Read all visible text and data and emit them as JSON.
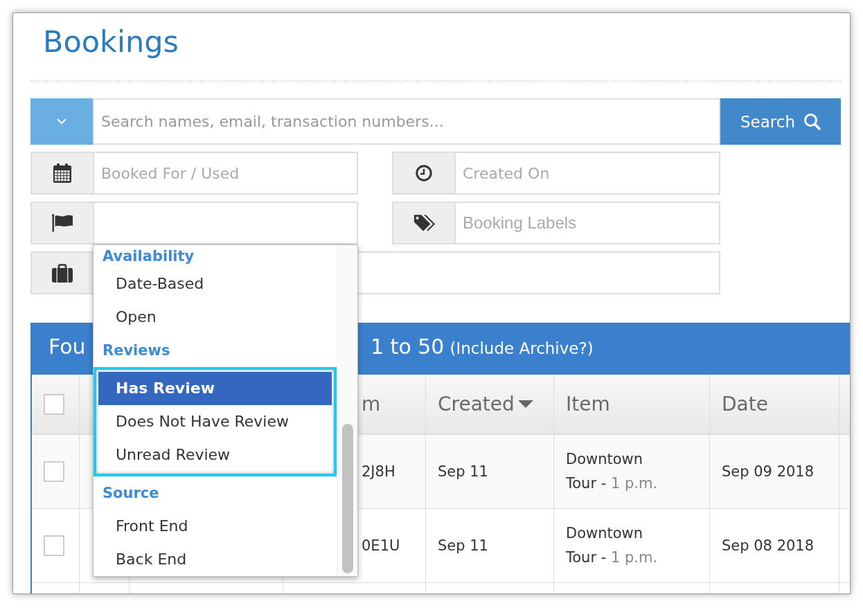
{
  "page": {
    "title": "Bookings"
  },
  "search": {
    "placeholder": "Search names, email, transaction numbers...",
    "button": "Search"
  },
  "filters": {
    "booked_for": {
      "placeholder": "Booked For / Used"
    },
    "created_on": {
      "placeholder": "Created On"
    },
    "flag_select": {
      "expanded": true,
      "groups": [
        {
          "label": "Availability",
          "highlighted": false,
          "options": [
            {
              "label": "Date-Based",
              "selected": false
            },
            {
              "label": "Open",
              "selected": false
            }
          ]
        },
        {
          "label": "Reviews",
          "highlighted": true,
          "options": [
            {
              "label": "Has Review",
              "selected": true
            },
            {
              "label": "Does Not Have Review",
              "selected": false
            },
            {
              "label": "Unread Review",
              "selected": false
            }
          ]
        },
        {
          "label": "Source",
          "highlighted": false,
          "options": [
            {
              "label": "Front End",
              "selected": false
            },
            {
              "label": "Back End",
              "selected": false
            }
          ]
        }
      ]
    },
    "labels": {
      "placeholder": "Booking Labels"
    }
  },
  "results_bar": {
    "text_start": "Fou",
    "text_end": "1 to 50",
    "archive_link": "(Include Archive?)"
  },
  "table": {
    "columns": [
      {
        "kind": "checkbox",
        "checked": false
      },
      {
        "kind": "blank"
      },
      {
        "kind": "blank"
      },
      {
        "kind": "text",
        "label": "m",
        "sorted": false
      },
      {
        "kind": "text",
        "label": "Created",
        "sorted": true
      },
      {
        "kind": "text",
        "label": "Item",
        "sorted": false
      },
      {
        "kind": "text",
        "label": "Date",
        "sorted": false
      },
      {
        "kind": "blank"
      }
    ],
    "rows": [
      {
        "checked": false,
        "column_4": "2J8H",
        "created": "Sep 11",
        "item": "Downtown Tour -",
        "item_time": "1 p.m.",
        "date": "Sep 09 2018"
      },
      {
        "checked": false,
        "column_4": "0E1U",
        "created": "Sep 11",
        "item": "Downtown Tour -",
        "item_time": "1 p.m.",
        "date": "Sep 08 2018"
      }
    ]
  }
}
